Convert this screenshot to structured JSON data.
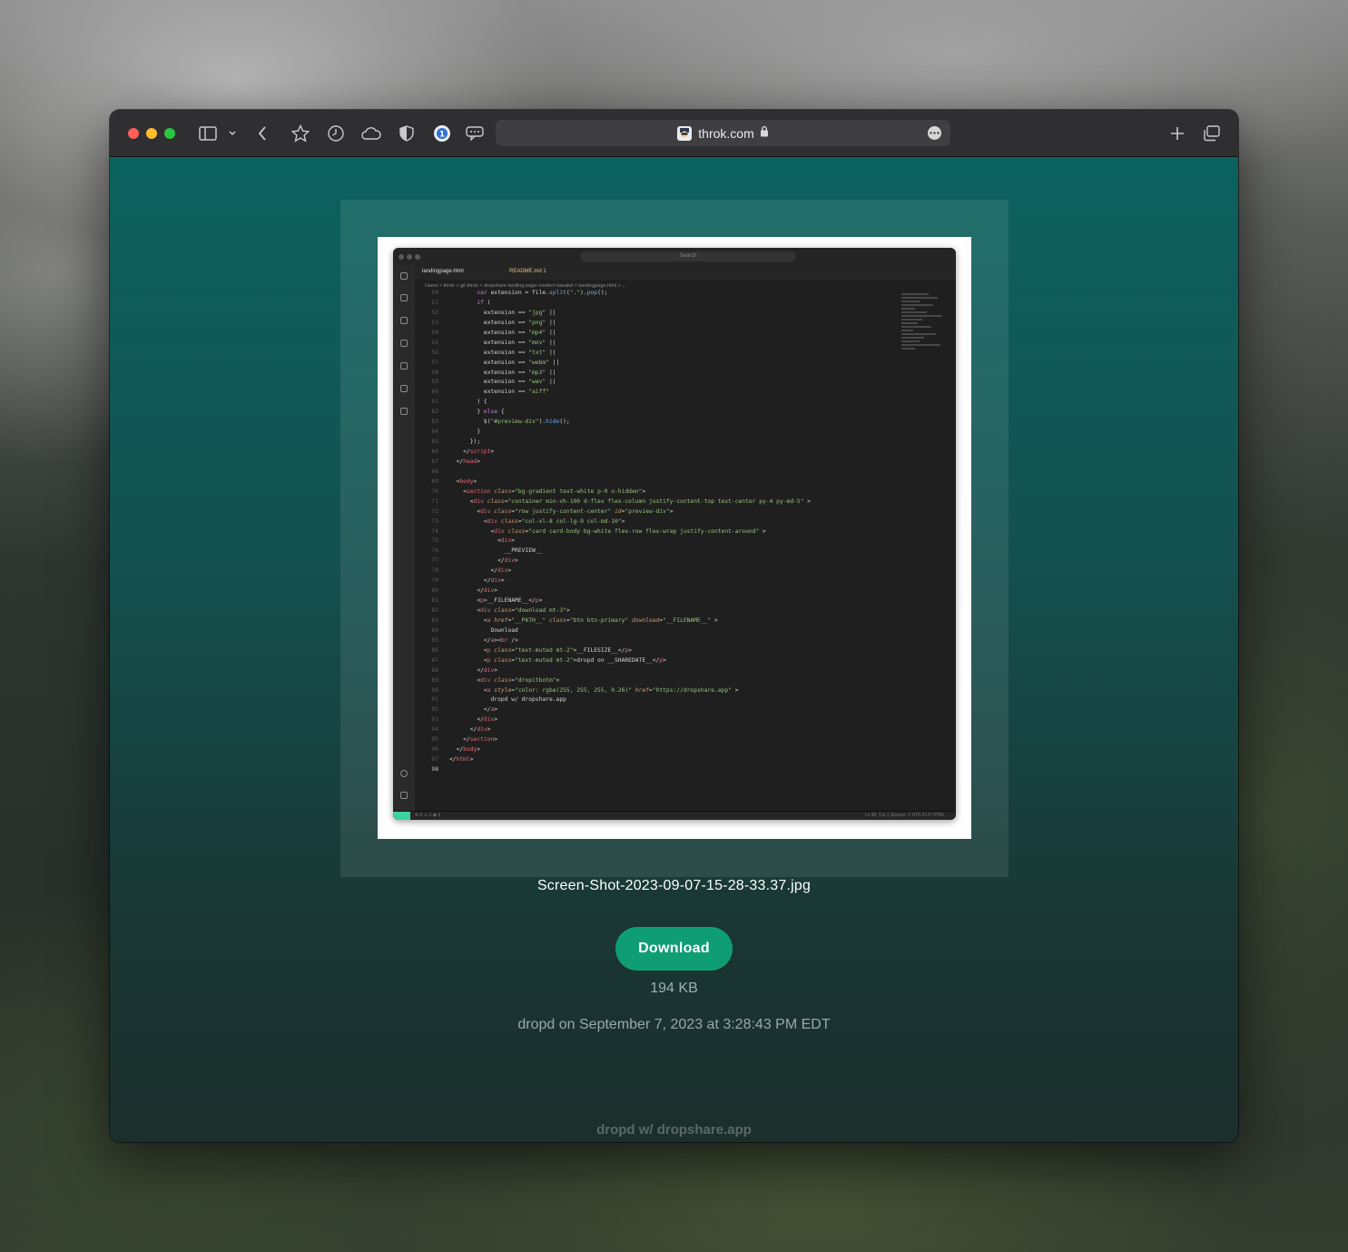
{
  "browser": {
    "domain": "throk.com",
    "icons": [
      "sidebar-icon",
      "chevron-down-icon",
      "back-icon",
      "star-icon",
      "history-icon",
      "cloud-icon",
      "shield-icon",
      "extension-icon",
      "chat-icon",
      "lock-icon",
      "more-icon",
      "new-tab-icon",
      "tab-overview-icon"
    ]
  },
  "preview": {
    "search_label": "Search",
    "tabs": [
      "landingpage.html",
      "README.md 1"
    ],
    "breadcrumb": "Users > throk > git throk > dropshare-landing-page-modern-tweakd > landingpage.html > ...",
    "status_left": "⊗ 0 ⚠ 1   ◉ 0",
    "status_right": "Ln 98, Col 1   Spaces: 2   UTF-8   LF   HTML"
  },
  "file": {
    "name": "Screen-Shot-2023-09-07-15-28-33.37.jpg",
    "download_label": "Download",
    "size": "194 KB",
    "shared": "dropd on September 7, 2023 at 3:28:43 PM EDT"
  },
  "footer": {
    "link_text": "dropd w/ dropshare.app"
  },
  "colors": {
    "accent_button": "#0f9d74",
    "page_top": "#0c625f",
    "page_bottom": "#1b2f2c"
  }
}
